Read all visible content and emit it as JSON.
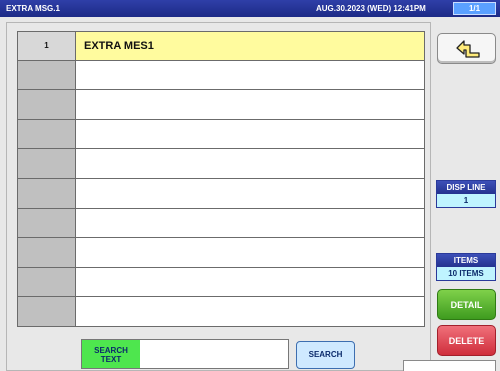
{
  "header": {
    "title": "EXTRA MSG.1",
    "datetime": "AUG.30.2023 (WED)  12:41PM",
    "page": "1/1"
  },
  "list": {
    "rows": [
      {
        "num": "1",
        "text": "EXTRA MES1",
        "selected": true
      },
      {
        "num": "",
        "text": ""
      },
      {
        "num": "",
        "text": ""
      },
      {
        "num": "",
        "text": ""
      },
      {
        "num": "",
        "text": ""
      },
      {
        "num": "",
        "text": ""
      },
      {
        "num": "",
        "text": ""
      },
      {
        "num": "",
        "text": ""
      },
      {
        "num": "",
        "text": ""
      },
      {
        "num": "",
        "text": ""
      }
    ]
  },
  "side": {
    "back_icon": "return-arrow-icon",
    "disp_line_label": "DISP LINE",
    "disp_line_value": "1",
    "items_label": "ITEMS",
    "items_value": "10 ITEMS",
    "detail_label": "DETAIL",
    "delete_label": "DELETE"
  },
  "search": {
    "label": "SEARCH\nTEXT",
    "value": "",
    "button_label": "SEARCH"
  },
  "colors": {
    "titlebar": "#1c2a86",
    "selected_row": "#fffb9e",
    "detail": "#3e9b1f",
    "delete": "#cf2e3c",
    "search_label": "#4ee64e"
  }
}
